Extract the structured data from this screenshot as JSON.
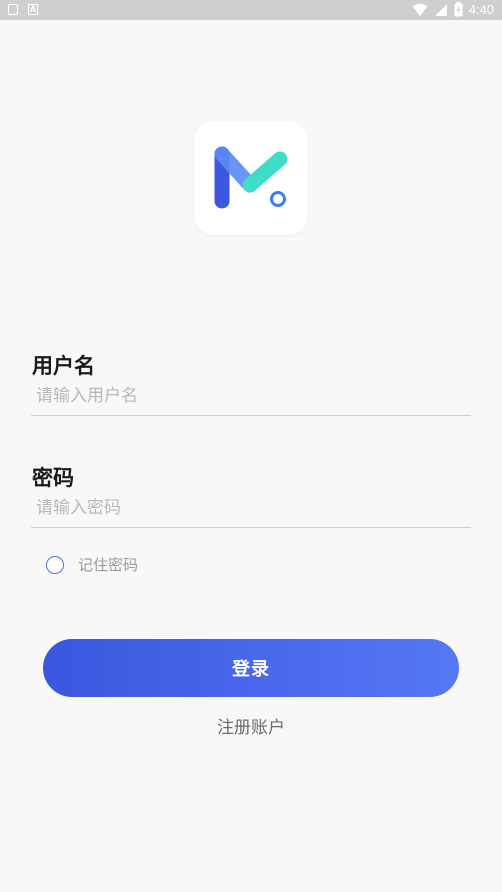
{
  "status_bar": {
    "time": "4:40",
    "icons": [
      "notification-icon",
      "a-icon",
      "wifi-icon",
      "signal-icon",
      "battery-icon"
    ]
  },
  "logo": {
    "icon": "m-logo-icon",
    "colors": {
      "blue": "#3d57e0",
      "light_blue": "#5b8af5",
      "teal": "#3fdcc7"
    }
  },
  "form": {
    "username_label": "用户名",
    "username_placeholder": "请输入用户名",
    "username_value": "",
    "password_label": "密码",
    "password_placeholder": "请输入密码",
    "password_value": "",
    "remember_label": "记住密码",
    "remember_checked": false
  },
  "actions": {
    "login_label": "登录",
    "register_label": "注册账户"
  },
  "colors": {
    "accent_start": "#3b56df",
    "accent_end": "#5578f5",
    "background": "#f8f8f9"
  }
}
